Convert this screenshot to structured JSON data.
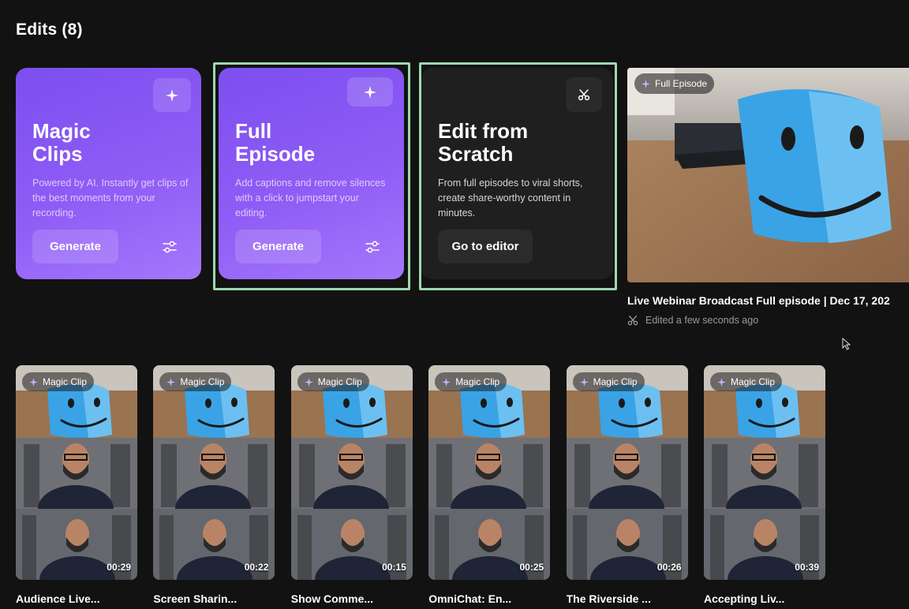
{
  "page": {
    "title": "Edits (8)"
  },
  "cards": [
    {
      "title_line1": "Magic",
      "title_line2": "Clips",
      "description": "Powered by AI. Instantly get clips of the best moments from your recording.",
      "button": "Generate",
      "icon": "sparkle-icon",
      "style": "purple"
    },
    {
      "title_line1": "Full",
      "title_line2": "Episode",
      "description": "Add captions and remove silences with a click to jumpstart your editing.",
      "button": "Generate",
      "icon": "sparkle-icon",
      "style": "purple"
    },
    {
      "title_line1": "Edit from",
      "title_line2": "Scratch",
      "description": "From full episodes to viral shorts, create share-worthy content in minutes.",
      "button": "Go to editor",
      "icon": "scissors-icon",
      "style": "dark"
    }
  ],
  "featured": {
    "badge": "Full Episode",
    "title": "Live Webinar Broadcast Full episode | Dec 17, 202",
    "meta": "Edited a few seconds ago"
  },
  "clips": [
    {
      "badge": "Magic Clip",
      "duration": "00:29",
      "title": "Audience Live..."
    },
    {
      "badge": "Magic Clip",
      "duration": "00:22",
      "title": "Screen Sharin..."
    },
    {
      "badge": "Magic Clip",
      "duration": "00:15",
      "title": "Show Comme..."
    },
    {
      "badge": "Magic Clip",
      "duration": "00:25",
      "title": "OmniChat: En..."
    },
    {
      "badge": "Magic Clip",
      "duration": "00:26",
      "title": "The Riverside ..."
    },
    {
      "badge": "Magic Clip",
      "duration": "00:39",
      "title": "Accepting Liv..."
    }
  ],
  "colors": {
    "background": "#121212",
    "purple_card": "#8a58f4",
    "dark_card": "#1f1f1f",
    "selection": "#9ed8b0",
    "badge_icon": "#c7b3ff"
  }
}
